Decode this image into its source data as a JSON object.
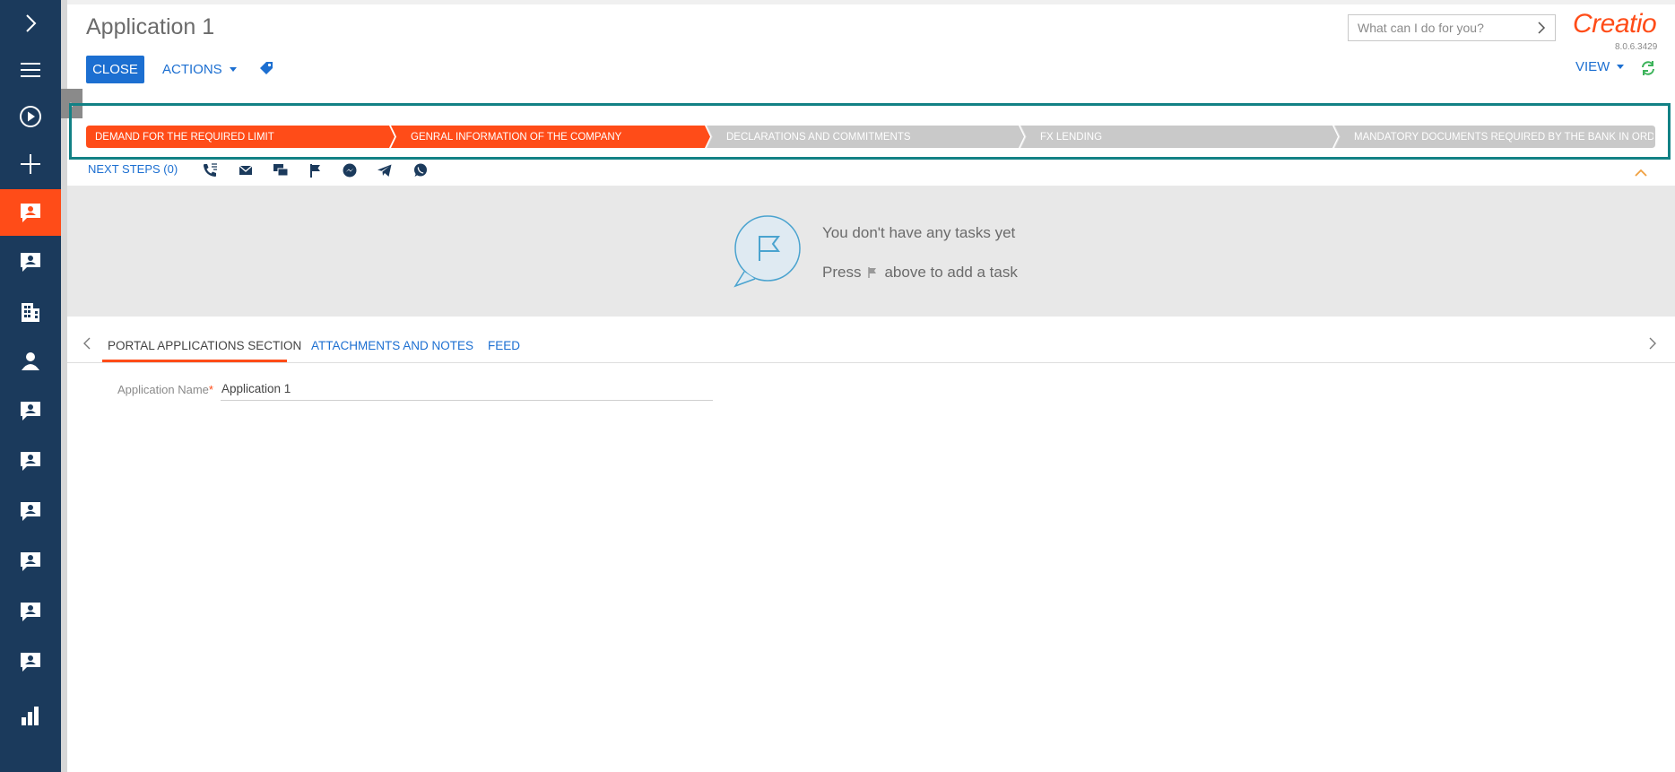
{
  "page": {
    "title": "Application 1"
  },
  "toolbar": {
    "close_label": "CLOSE",
    "actions_label": "ACTIONS",
    "view_label": "VIEW"
  },
  "search": {
    "placeholder": "What can I do for you?"
  },
  "brand": {
    "logo": "Creatio",
    "version": "8.0.6.3429",
    "accent": "#ff4c18",
    "primary": "#1c6fd1",
    "rail": "#1b3a5c"
  },
  "rail": {
    "items": [
      {
        "icon": "chevron-right-icon"
      },
      {
        "icon": "menu-icon"
      },
      {
        "icon": "play-circle-icon"
      },
      {
        "icon": "plus-icon"
      },
      {
        "icon": "contact-card-icon",
        "active": true
      },
      {
        "icon": "contact-card-icon"
      },
      {
        "icon": "building-icon"
      },
      {
        "icon": "person-icon"
      },
      {
        "icon": "contact-card-icon"
      },
      {
        "icon": "contact-card-icon"
      },
      {
        "icon": "contact-card-icon"
      },
      {
        "icon": "contact-card-icon"
      },
      {
        "icon": "contact-card-icon"
      },
      {
        "icon": "contact-card-icon"
      },
      {
        "icon": "bar-chart-icon"
      }
    ]
  },
  "stages": [
    {
      "label": "DEMAND FOR THE REQUIRED LIMIT",
      "state": "done"
    },
    {
      "label": "GENRAL INFORMATION OF THE COMPANY",
      "state": "done"
    },
    {
      "label": "DECLARATIONS AND COMMITMENTS",
      "state": "todo"
    },
    {
      "label": "FX LENDING",
      "state": "todo"
    },
    {
      "label": "MANDATORY DOCUMENTS REQUIRED BY THE BANK IN ORD...",
      "state": "todo"
    }
  ],
  "next_steps": {
    "label": "NEXT STEPS (0)",
    "icons": [
      "phone-icon",
      "email-icon",
      "chat-icon",
      "flag-icon",
      "messenger-icon",
      "telegram-icon",
      "whatsapp-icon"
    ]
  },
  "tasks_empty": {
    "line1": "You don't have any tasks yet",
    "line2_pre": "Press",
    "line2_post": "above to add a task"
  },
  "tabs": [
    {
      "label": "PORTAL APPLICATIONS SECTION",
      "active": true
    },
    {
      "label": "ATTACHMENTS AND NOTES",
      "active": false
    },
    {
      "label": "FEED",
      "active": false
    }
  ],
  "form": {
    "application_name_label": "Application Name",
    "application_name_value": "Application 1"
  }
}
